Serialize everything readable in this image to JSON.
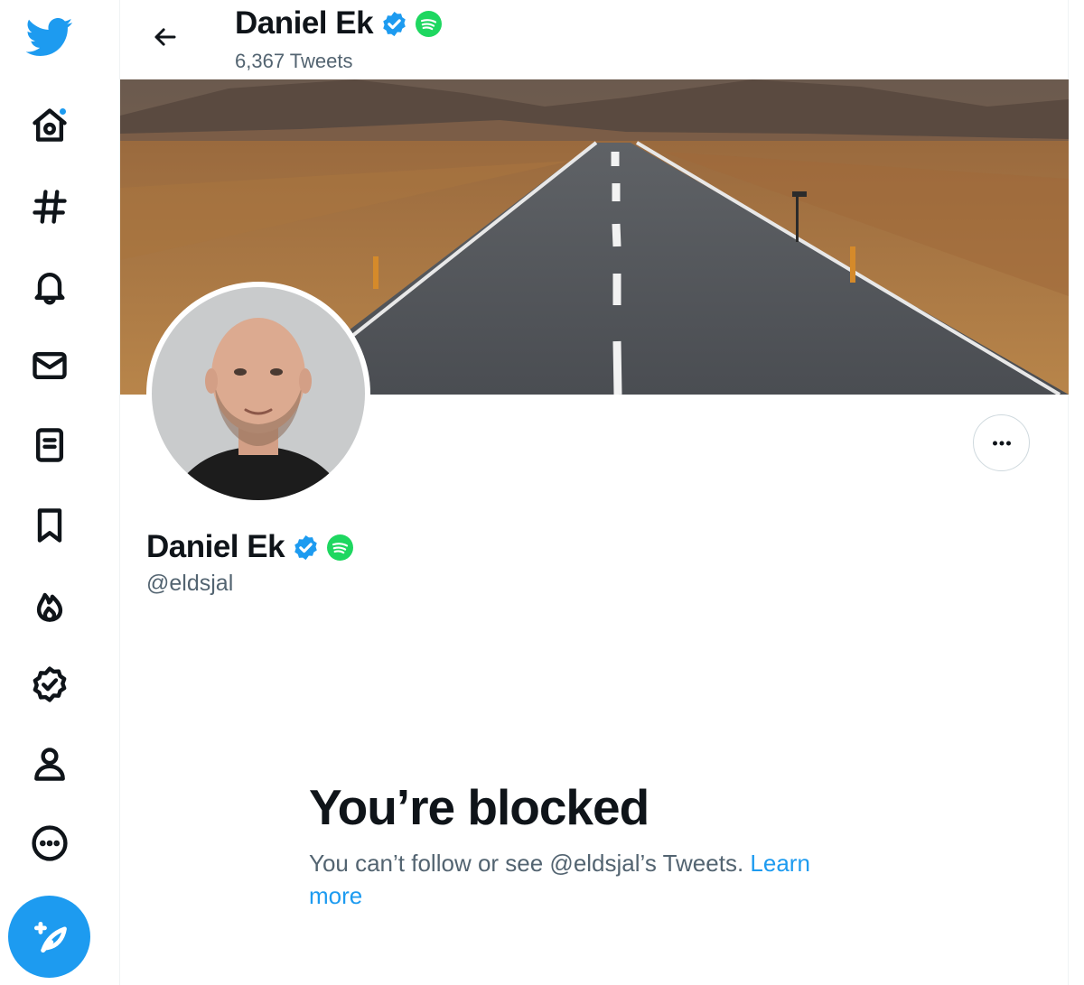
{
  "colors": {
    "accent": "#1d9bf0",
    "text": "#0f1419",
    "muted": "#536471",
    "spotify": "#1ed760"
  },
  "sidebar": {
    "items": [
      {
        "name": "twitter-logo",
        "icon": "bird-icon"
      },
      {
        "name": "home",
        "icon": "home-icon",
        "has_notification_dot": true
      },
      {
        "name": "explore",
        "icon": "hashtag-icon"
      },
      {
        "name": "notifications",
        "icon": "bell-icon"
      },
      {
        "name": "messages",
        "icon": "envelope-icon"
      },
      {
        "name": "lists",
        "icon": "list-icon"
      },
      {
        "name": "bookmarks",
        "icon": "bookmark-icon"
      },
      {
        "name": "topics",
        "icon": "flame-icon"
      },
      {
        "name": "verified",
        "icon": "verified-badge-icon"
      },
      {
        "name": "profile",
        "icon": "person-icon"
      },
      {
        "name": "more",
        "icon": "more-circle-icon"
      }
    ],
    "compose_icon": "compose-tweet-icon"
  },
  "header": {
    "display_name": "Daniel Ek",
    "tweet_count": "6,367 Tweets"
  },
  "profile": {
    "display_name": "Daniel Ek",
    "handle": "@eldsjal",
    "verified": true,
    "affiliation_icon": "spotify-icon"
  },
  "blocked": {
    "title": "You’re blocked",
    "message": "You can’t follow or see @eldsjal’s Tweets.",
    "link": "Learn more"
  }
}
